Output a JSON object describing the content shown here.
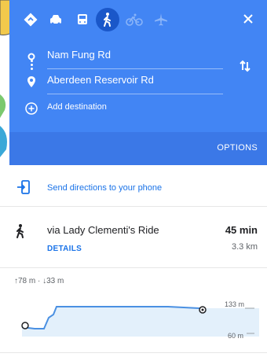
{
  "header": {
    "accent_color": "#4285f4",
    "transport_modes": [
      {
        "name": "best-route",
        "icon": "diamond-directions-icon",
        "active": false
      },
      {
        "name": "driving",
        "icon": "car-icon",
        "active": false
      },
      {
        "name": "transit",
        "icon": "bus-icon",
        "active": false
      },
      {
        "name": "walking",
        "icon": "walking-icon",
        "active": true
      },
      {
        "name": "cycling",
        "icon": "bicycle-icon",
        "active": false
      },
      {
        "name": "flights",
        "icon": "airplane-icon",
        "active": false
      }
    ],
    "close_icon": "close-icon",
    "origin": "Nam Fung Rd",
    "destination": "Aberdeen Reservoir Rd",
    "add_destination": "Add destination",
    "options_label": "OPTIONS"
  },
  "send": {
    "label": "Send directions to your phone"
  },
  "route": {
    "via": "via Lady Clementi's Ride",
    "duration": "45 min",
    "distance": "3.3 km",
    "details_label": "DETAILS"
  },
  "elevation": {
    "summary": "↑78 m · ↓33 m",
    "max_label": "133 m",
    "min_label": "60 m"
  }
}
